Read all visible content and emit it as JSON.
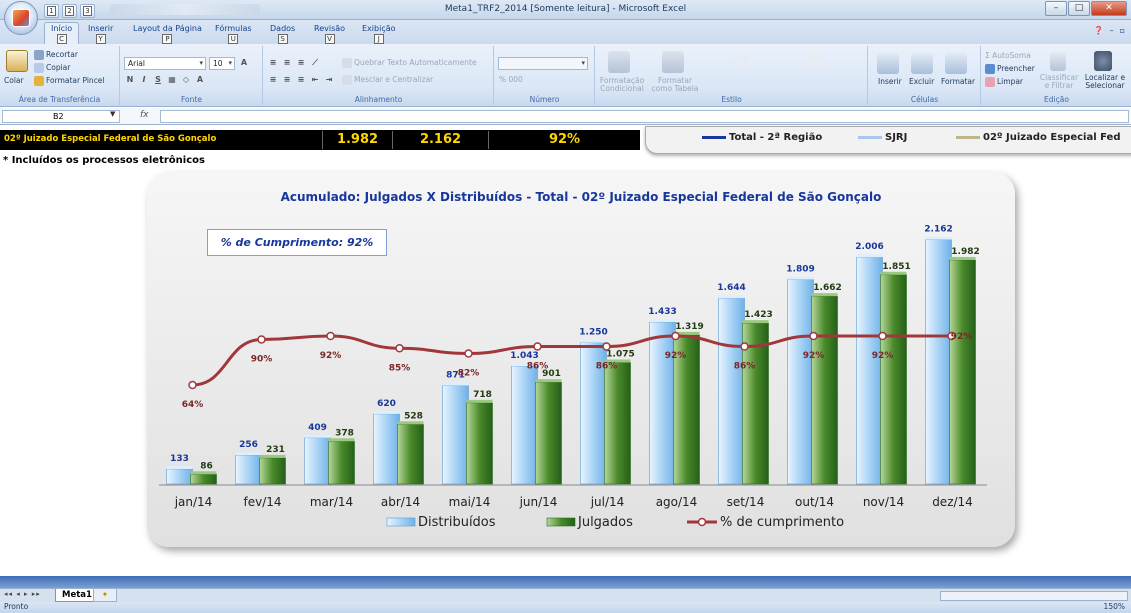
{
  "window": {
    "title": "Meta1_TRF2_2014 [Somente leitura] - Microsoft Excel",
    "controls": [
      "–",
      "□",
      "✕"
    ]
  },
  "qat": {
    "keytips": [
      "1",
      "2",
      "3"
    ]
  },
  "tabs": [
    {
      "label": "Início",
      "keytip": "C"
    },
    {
      "label": "Inserir",
      "keytip": "Y"
    },
    {
      "label": "Layout da Página",
      "keytip": "P"
    },
    {
      "label": "Fórmulas",
      "keytip": "U"
    },
    {
      "label": "Dados",
      "keytip": "S"
    },
    {
      "label": "Revisão",
      "keytip": "V"
    },
    {
      "label": "Exibição",
      "keytip": "J"
    }
  ],
  "ribbon": {
    "clipboard": {
      "label": "Área de Transferência",
      "paste": "Colar",
      "cut": "Recortar",
      "copy": "Copiar",
      "format_painter": "Formatar Pincel"
    },
    "font": {
      "label": "Fonte",
      "name": "Arial",
      "size": "10"
    },
    "alignment": {
      "label": "Alinhamento",
      "wrap": "Quebrar Texto Automaticamente",
      "merge": "Mesclar e Centralizar"
    },
    "number": {
      "label": "Número",
      "format_symbols": "% 000"
    },
    "style": {
      "label": "Estilo",
      "conditional": "Formatação Condicional",
      "as_table": "Formatar como Tabela"
    },
    "cells": {
      "label": "Células",
      "insert": "Inserir",
      "delete": "Excluir",
      "format": "Formatar"
    },
    "editing": {
      "label": "Edição",
      "autosum": "AutoSoma",
      "fill": "Preencher",
      "clear": "Limpar",
      "sort": "Classificar e Filtrar",
      "find": "Localizar e Selecionar"
    }
  },
  "formula_bar": {
    "name_box": "B2",
    "fx": "fx"
  },
  "sheet": {
    "court_name": "02º Juizado Especial Federal de São Gonçalo",
    "julgados_total": "1.982",
    "distribuidos_total": "2.162",
    "cumprimento": "92%",
    "footnote": "* Incluídos os processos eletrônicos",
    "top_legend": {
      "item1": "Total - 2ª Região",
      "item2": "SJRJ",
      "item3": "02º Juizado Especial Fed"
    }
  },
  "chart_data": {
    "type": "bar",
    "title": "Acumulado: Julgados X Distribuídos  -  Total   -   02º Juizado Especial Federal de São Gonçalo",
    "annotation": "% de Cumprimento: 92%",
    "categories": [
      "jan/14",
      "fev/14",
      "mar/14",
      "abr/14",
      "mai/14",
      "jun/14",
      "jul/14",
      "ago/14",
      "set/14",
      "out/14",
      "nov/14",
      "dez/14"
    ],
    "series": [
      {
        "name": "Distribuídos",
        "values": [
          133,
          256,
          409,
          620,
          871,
          1043,
          1250,
          1433,
          1644,
          1809,
          2006,
          2162
        ],
        "labels": [
          "133",
          "256",
          "409",
          "620",
          "871",
          "1.043",
          "1.250",
          "1.433",
          "1.644",
          "1.809",
          "2.006",
          "2.162"
        ],
        "color": "#a9d3f5"
      },
      {
        "name": "Julgados",
        "values": [
          86,
          231,
          378,
          528,
          718,
          901,
          1075,
          1319,
          1423,
          1662,
          1851,
          1982
        ],
        "labels": [
          "86",
          "231",
          "378",
          "528",
          "718",
          "901",
          "1.075",
          "1.319",
          "1.423",
          "1.662",
          "1.851",
          "1.982"
        ],
        "color": "#4a8a2a"
      },
      {
        "name": "% de cumprimento",
        "type": "line",
        "values": [
          64,
          90,
          92,
          85,
          82,
          86,
          86,
          92,
          86,
          92,
          92,
          92
        ],
        "labels": [
          "64%",
          "90%",
          "92%",
          "85%",
          "82%",
          "86%",
          "86%",
          "92%",
          "86%",
          "92%",
          "92%",
          "92%"
        ],
        "color": "#a0373a"
      }
    ],
    "ylim": [
      0,
      2300
    ],
    "legend": "bottom",
    "grid": false
  },
  "sheet_tabs": {
    "active": "Meta1"
  },
  "status": {
    "text": "Pronto",
    "zoom": "150%"
  }
}
